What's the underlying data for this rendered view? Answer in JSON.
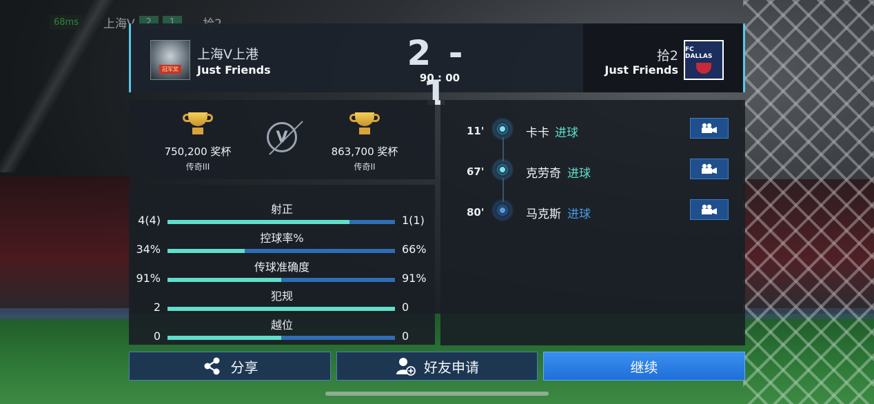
{
  "hud": {
    "ping": "68ms",
    "team": "上海V",
    "score_home": "2",
    "score_away": "1",
    "away": "拾2"
  },
  "header": {
    "home_name": "上海V上港",
    "home_sub": "Just Friends",
    "home_badge": "冠军奖",
    "score": "2 - 1",
    "time": "90 : 00",
    "away_name": "拾2",
    "away_sub": "Just Friends",
    "away_logo_text": "FC DALLAS"
  },
  "trophies": {
    "home_value": "750,200 奖杯",
    "home_rank": "传奇III",
    "vs": "V",
    "away_value": "863,700 奖杯",
    "away_rank": "传奇II"
  },
  "stats": [
    {
      "label": "射正",
      "home": "4(4)",
      "away": "1(1)",
      "home_share": 0.8
    },
    {
      "label": "控球率%",
      "home": "34%",
      "away": "66%",
      "home_share": 0.34
    },
    {
      "label": "传球准确度",
      "home": "91%",
      "away": "91%",
      "home_share": 0.5
    },
    {
      "label": "犯规",
      "home": "2",
      "away": "0",
      "home_share": 1.0
    },
    {
      "label": "越位",
      "home": "0",
      "away": "0",
      "home_share": 0.5
    }
  ],
  "events": [
    {
      "minute": "11'",
      "player": "卡卡",
      "type": "进球",
      "team": "home"
    },
    {
      "minute": "67'",
      "player": "克劳奇",
      "type": "进球",
      "team": "home"
    },
    {
      "minute": "80'",
      "player": "马克斯",
      "type": "进球",
      "team": "away"
    }
  ],
  "buttons": {
    "share": "分享",
    "friend": "好友申请",
    "continue": "继续"
  },
  "colors": {
    "accent": "#58c8e8",
    "home_bar": "#5fdfc9",
    "away_bar": "#2f6eb5",
    "goal_home": "#5fdfc9",
    "goal_away": "#4a9ae8"
  }
}
